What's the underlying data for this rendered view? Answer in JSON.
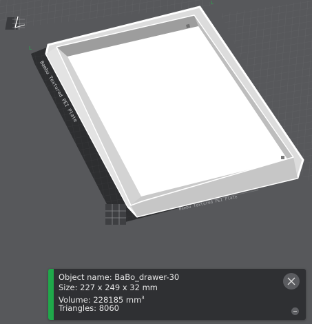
{
  "object_info": {
    "name_label": "Object name:",
    "name_value": "BaBo_drawer-30",
    "size_label": "Size:",
    "size_value": "227 x 249 x 32 mm",
    "volume_label": "Volume:",
    "volume_value": "228185 mm",
    "volume_unit_power": "3",
    "triangles_label": "Triangles:",
    "triangles_value": "8060"
  },
  "plate_text": {
    "left_edge": "Bambu Textured PEI Plate",
    "bottom_edge": "Bambu Textured PEI Plate"
  },
  "colors": {
    "background": "#57585b",
    "bed_surface": "#2b2c2e",
    "model_fill": "#ffffff",
    "model_wall": "#ebebeb",
    "selection_outline": "#ffffff",
    "accent_green": "#1fa84a",
    "panel_bg": "#2f3033"
  },
  "icons": [
    "close-icon",
    "collapse-icon",
    "axis-gizmo-icon"
  ]
}
